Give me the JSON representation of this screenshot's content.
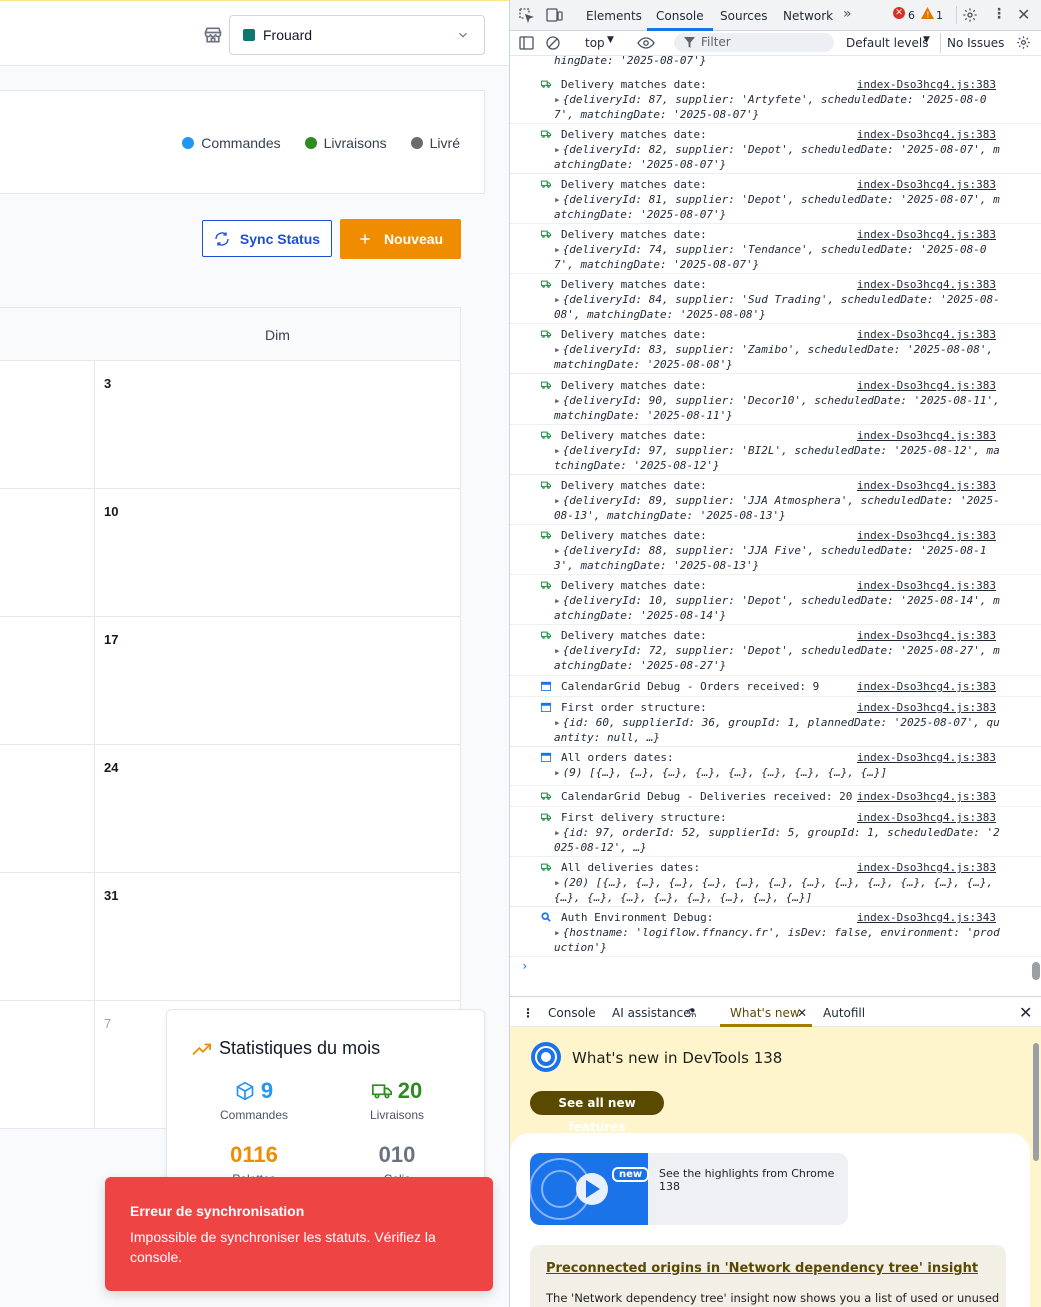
{
  "app": {
    "store": {
      "name": "Frouard",
      "color": "#0f766e"
    },
    "legend": [
      {
        "label": "Commandes",
        "color": "#2196f3"
      },
      {
        "label": "Livraisons",
        "color": "#2e8b1f"
      },
      {
        "label": "Livré",
        "color": "#6b6b6b"
      }
    ],
    "buttons": {
      "sync": "Sync Status",
      "new": "Nouveau"
    },
    "calendar": {
      "column_header": "Dim",
      "days": [
        "3",
        "10",
        "17",
        "24",
        "31",
        "7"
      ]
    },
    "stats": {
      "title": "Statistiques du mois",
      "orders_value": "9",
      "orders_label": "Commandes",
      "deliveries_value": "20",
      "deliveries_label": "Livraisons",
      "pallets_value": "0116",
      "pallets_label": "Palettes",
      "parcels_value": "010",
      "parcels_label": "Colis"
    },
    "toast": {
      "title": "Erreur de synchronisation",
      "message": "Impossible de synchroniser les statuts. Vérifiez la console."
    }
  },
  "devtools": {
    "tabs": [
      "Elements",
      "Console",
      "Sources",
      "Network"
    ],
    "error_count": "6",
    "warning_count": "1",
    "toolbar": {
      "context": "top",
      "filter_placeholder": "Filter",
      "levels": "Default levels",
      "issues": "No Issues"
    },
    "top_fragment": "hingDate: '2025-08-07'}",
    "logs": [
      {
        "icon": "truck",
        "msg": "Delivery matches date:",
        "src": "index-Dso3hcg4.js:383",
        "obj": "{deliveryId: 87, supplier: 'Artyfete', scheduledDate: '2025-08-07', matchingDate: '2025-08-07'}"
      },
      {
        "icon": "truck",
        "msg": "Delivery matches date:",
        "src": "index-Dso3hcg4.js:383",
        "obj": "{deliveryId: 82, supplier: 'Depot', scheduledDate: '2025-08-07', matchingDate: '2025-08-07'}"
      },
      {
        "icon": "truck",
        "msg": "Delivery matches date:",
        "src": "index-Dso3hcg4.js:383",
        "obj": "{deliveryId: 81, supplier: 'Depot', scheduledDate: '2025-08-07', matchingDate: '2025-08-07'}"
      },
      {
        "icon": "truck",
        "msg": "Delivery matches date:",
        "src": "index-Dso3hcg4.js:383",
        "obj": "{deliveryId: 74, supplier: 'Tendance', scheduledDate: '2025-08-07', matchingDate: '2025-08-07'}"
      },
      {
        "icon": "truck",
        "msg": "Delivery matches date:",
        "src": "index-Dso3hcg4.js:383",
        "obj": "{deliveryId: 84, supplier: 'Sud Trading', scheduledDate: '2025-08-08', matchingDate: '2025-08-08'}"
      },
      {
        "icon": "truck",
        "msg": "Delivery matches date:",
        "src": "index-Dso3hcg4.js:383",
        "obj": "{deliveryId: 83, supplier: 'Zamibo', scheduledDate: '2025-08-08', matchingDate: '2025-08-08'}"
      },
      {
        "icon": "truck",
        "msg": "Delivery matches date:",
        "src": "index-Dso3hcg4.js:383",
        "obj": "{deliveryId: 90, supplier: 'Decor10', scheduledDate: '2025-08-11', matchingDate: '2025-08-11'}"
      },
      {
        "icon": "truck",
        "msg": "Delivery matches date:",
        "src": "index-Dso3hcg4.js:383",
        "obj": "{deliveryId: 97, supplier: 'BI2L', scheduledDate: '2025-08-12', matchingDate: '2025-08-12'}"
      },
      {
        "icon": "truck",
        "msg": "Delivery matches date:",
        "src": "index-Dso3hcg4.js:383",
        "obj": "{deliveryId: 89, supplier: 'JJA Atmosphera', scheduledDate: '2025-08-13', matchingDate: '2025-08-13'}"
      },
      {
        "icon": "truck",
        "msg": "Delivery matches date:",
        "src": "index-Dso3hcg4.js:383",
        "obj": "{deliveryId: 88, supplier: 'JJA Five', scheduledDate: '2025-08-13', matchingDate: '2025-08-13'}"
      },
      {
        "icon": "truck",
        "msg": "Delivery matches date:",
        "src": "index-Dso3hcg4.js:383",
        "obj": "{deliveryId: 10, supplier: 'Depot', scheduledDate: '2025-08-14', matchingDate: '2025-08-14'}"
      },
      {
        "icon": "truck",
        "msg": "Delivery matches date:",
        "src": "index-Dso3hcg4.js:383",
        "obj": "{deliveryId: 72, supplier: 'Depot', scheduledDate: '2025-08-27', matchingDate: '2025-08-27'}"
      },
      {
        "icon": "calendar",
        "msg": "CalendarGrid Debug - Orders received: 9",
        "src": "index-Dso3hcg4.js:383",
        "obj": ""
      },
      {
        "icon": "calendar",
        "msg": "First order structure:",
        "src": "index-Dso3hcg4.js:383",
        "obj": "{id: 60, supplierId: 36, groupId: 1, plannedDate: '2025-08-07', quantity: null, …}"
      },
      {
        "icon": "calendar",
        "msg": "All orders dates:",
        "src": "index-Dso3hcg4.js:383",
        "obj": "(9) [{…}, {…}, {…}, {…}, {…}, {…}, {…}, {…}, {…}]"
      },
      {
        "icon": "truck",
        "msg": "CalendarGrid Debug - Deliveries received: 20",
        "src": "index-Dso3hcg4.js:383",
        "obj": ""
      },
      {
        "icon": "truck",
        "msg": "First delivery structure:",
        "src": "index-Dso3hcg4.js:383",
        "obj": "{id: 97, orderId: 52, supplierId: 5, groupId: 1, scheduledDate: '2025-08-12', …}"
      },
      {
        "icon": "truck",
        "msg": "All deliveries dates:",
        "src": "index-Dso3hcg4.js:383",
        "obj": "(20) [{…}, {…}, {…}, {…}, {…}, {…}, {…}, {…}, {…}, {…}, {…}, {…}, {…}, {…}, {…}, {…}, {…}, {…}, {…}, {…}]"
      },
      {
        "icon": "magnifier",
        "msg": "Auth Environment Debug:",
        "src": "index-Dso3hcg4.js:343",
        "obj": "{hostname: 'logiflow.ffnancy.fr', isDev: false, environment: 'production'}"
      }
    ],
    "drawer": {
      "tabs": [
        "Console",
        "AI assistance",
        "What's new",
        "Autofill"
      ],
      "title": "What's new in DevTools 138",
      "see_all": "See all new features",
      "badge": "new",
      "highlight": "See the highlights from Chrome 138",
      "article_title": "Preconnected origins in 'Network dependency tree' insight",
      "article_text": "The 'Network dependency tree' insight now shows you a list of used or unused"
    }
  }
}
